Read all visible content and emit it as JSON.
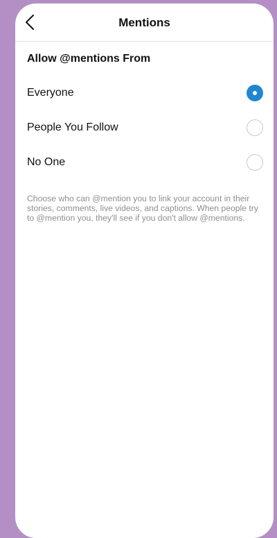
{
  "header": {
    "title": "Mentions",
    "back_icon": "chevron-left-icon"
  },
  "section": {
    "title": "Allow @mentions From"
  },
  "options": [
    {
      "label": "Everyone",
      "selected": true
    },
    {
      "label": "People You Follow",
      "selected": false
    },
    {
      "label": "No One",
      "selected": false
    }
  ],
  "description": "Choose who can @mention you to link your account in their stories, comments, live videos, and captions. When people try to @mention you, they'll see if you don't allow @mentions.",
  "colors": {
    "background": "#b48fc6",
    "accent": "#1f86d1",
    "radio_border": "#c9c9c9",
    "secondary_text": "#8e8e8e"
  }
}
